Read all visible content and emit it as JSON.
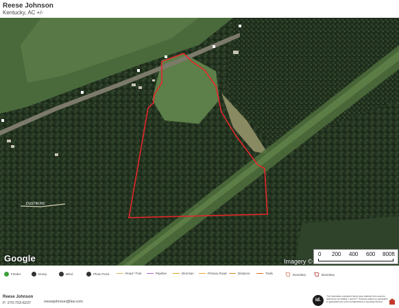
{
  "header": {
    "title": "Reese Johnson",
    "subtitle": "Kentucky, AC +/-"
  },
  "map": {
    "road_label": "DUSTIN RD",
    "attribution": "Imagery ©",
    "provider_logo": "Google",
    "boundary_color": "#e8262a",
    "scale": {
      "labels": [
        "0",
        "200",
        "400",
        "600",
        "800ft"
      ]
    }
  },
  "legend": [
    {
      "label": "Feeder",
      "color": "#3aa03a",
      "icon": "feeder-icon"
    },
    {
      "label": "Dump",
      "color": "#333333",
      "icon": "dump-icon"
    },
    {
      "label": "Blind",
      "color": "#333333",
      "icon": "blind-icon"
    },
    {
      "label": "Photo Point",
      "color": "#333333",
      "icon": "photo-point-icon"
    },
    {
      "label": "Road / Trail",
      "color": "#d9b24a",
      "icon": "road-line"
    },
    {
      "label": "Pipeline",
      "color": "#b05cc8",
      "icon": "pipeline-line"
    },
    {
      "label": "Direction",
      "color": "#e0a020",
      "icon": "direction-line"
    },
    {
      "label": "Primary Road",
      "color": "#f0a030",
      "icon": "primary-road-line"
    },
    {
      "label": "Distance",
      "color": "#e08a20",
      "icon": "distance-line"
    },
    {
      "label": "Trails",
      "color": "#e06a20",
      "icon": "trails-line"
    },
    {
      "label": "Boundary",
      "color": "#d27a5a",
      "icon": "boundary-icon"
    },
    {
      "label": "Boundary",
      "color": "#b23030",
      "icon": "boundary-icon-2"
    }
  ],
  "footer": {
    "name": "Reese Johnson",
    "phone": "P: 270-703-6237",
    "email": "reesejohnson@kw.com",
    "logo_text": "id.",
    "disclaimer": "The information contained herein was obtained from sources deemed to be reliable. Land id™ Services makes no warranties or guarantees as to the completeness or accuracy thereof."
  }
}
